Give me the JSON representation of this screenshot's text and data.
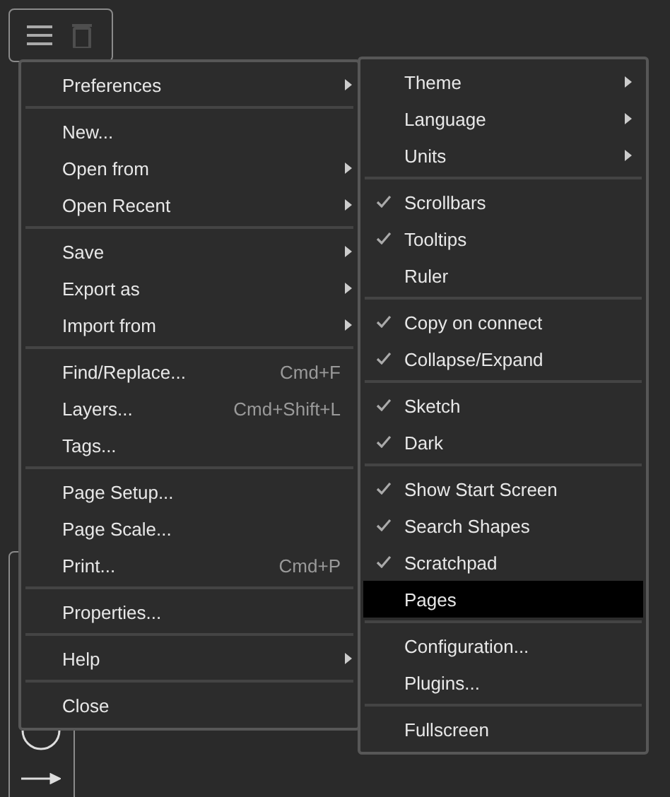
{
  "toolbar": {
    "buttons": [
      {
        "kind": "menu",
        "disabled": false
      },
      {
        "kind": "trash",
        "disabled": true
      }
    ]
  },
  "menu": {
    "groups": [
      [
        {
          "label": "Preferences",
          "submenu": true
        }
      ],
      [
        {
          "label": "New...",
          "submenu": false
        },
        {
          "label": "Open from",
          "submenu": true
        },
        {
          "label": "Open Recent",
          "submenu": true
        }
      ],
      [
        {
          "label": "Save",
          "submenu": true
        },
        {
          "label": "Export as",
          "submenu": true
        },
        {
          "label": "Import from",
          "submenu": true
        }
      ],
      [
        {
          "label": "Find/Replace...",
          "submenu": false,
          "shortcut": "Cmd+F"
        },
        {
          "label": "Layers...",
          "submenu": false,
          "shortcut": "Cmd+Shift+L"
        },
        {
          "label": "Tags...",
          "submenu": false
        }
      ],
      [
        {
          "label": "Page Setup...",
          "submenu": false
        },
        {
          "label": "Page Scale...",
          "submenu": false
        },
        {
          "label": "Print...",
          "submenu": false,
          "shortcut": "Cmd+P"
        }
      ],
      [
        {
          "label": "Properties...",
          "submenu": false
        }
      ],
      [
        {
          "label": "Help",
          "submenu": true
        }
      ],
      [
        {
          "label": "Close",
          "submenu": false
        }
      ]
    ]
  },
  "submenu": {
    "groups": [
      [
        {
          "label": "Theme",
          "submenu": true,
          "checked": false,
          "selected": false
        },
        {
          "label": "Language",
          "submenu": true,
          "checked": false,
          "selected": false
        },
        {
          "label": "Units",
          "submenu": true,
          "checked": false,
          "selected": false
        }
      ],
      [
        {
          "label": "Scrollbars",
          "submenu": false,
          "checked": true,
          "selected": false
        },
        {
          "label": "Tooltips",
          "submenu": false,
          "checked": true,
          "selected": false
        },
        {
          "label": "Ruler",
          "submenu": false,
          "checked": false,
          "selected": false
        }
      ],
      [
        {
          "label": "Copy on connect",
          "submenu": false,
          "checked": true,
          "selected": false
        },
        {
          "label": "Collapse/Expand",
          "submenu": false,
          "checked": true,
          "selected": false
        }
      ],
      [
        {
          "label": "Sketch",
          "submenu": false,
          "checked": true,
          "selected": false
        },
        {
          "label": "Dark",
          "submenu": false,
          "checked": true,
          "selected": false
        }
      ],
      [
        {
          "label": "Show Start Screen",
          "submenu": false,
          "checked": true,
          "selected": false
        },
        {
          "label": "Search Shapes",
          "submenu": false,
          "checked": true,
          "selected": false
        },
        {
          "label": "Scratchpad",
          "submenu": false,
          "checked": true,
          "selected": false
        },
        {
          "label": "Pages",
          "submenu": false,
          "checked": false,
          "selected": true
        }
      ],
      [
        {
          "label": "Configuration...",
          "submenu": false,
          "checked": false,
          "selected": false
        },
        {
          "label": "Plugins...",
          "submenu": false,
          "checked": false,
          "selected": false
        }
      ],
      [
        {
          "label": "Fullscreen",
          "submenu": false,
          "checked": false,
          "selected": false
        }
      ]
    ]
  }
}
